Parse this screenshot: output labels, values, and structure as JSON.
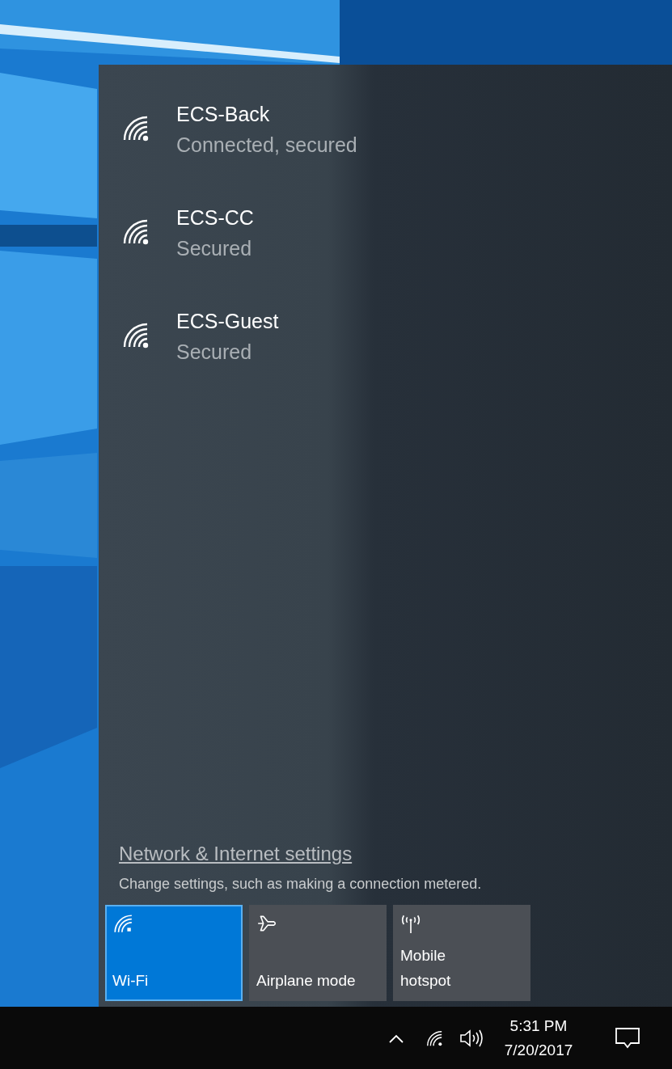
{
  "networks": [
    {
      "name": "ECS-Back",
      "status": "Connected, secured"
    },
    {
      "name": "ECS-CC",
      "status": "Secured"
    },
    {
      "name": "ECS-Guest",
      "status": "Secured"
    }
  ],
  "settings": {
    "link": "Network & Internet settings",
    "description": "Change settings, such as making a connection metered."
  },
  "quick_actions": [
    {
      "label": "Wi-Fi",
      "selected": true
    },
    {
      "label": "Airplane mode",
      "selected": false
    },
    {
      "label": "Mobile hotspot",
      "selected": false
    }
  ],
  "taskbar": {
    "time": "5:31 PM",
    "date": "7/20/2017"
  }
}
